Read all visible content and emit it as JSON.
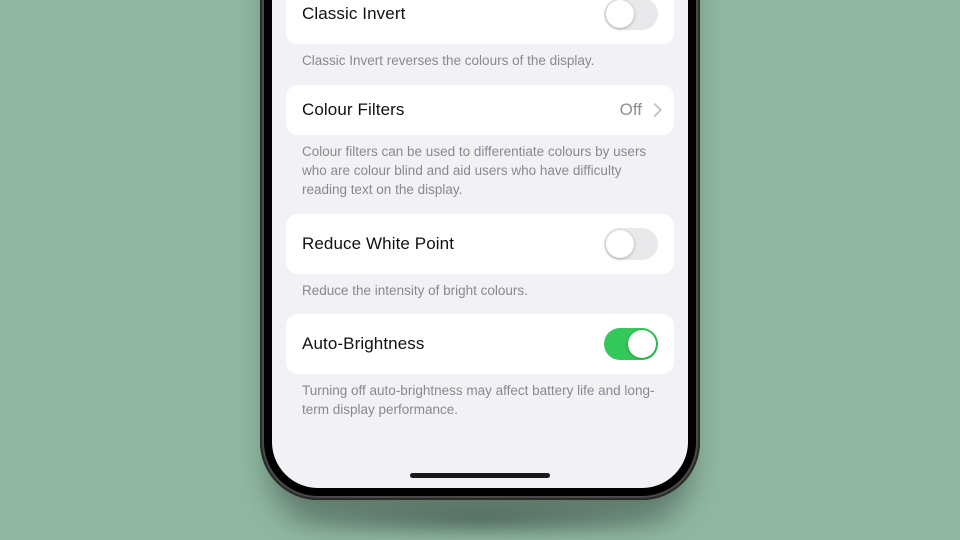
{
  "colors": {
    "background": "#8fb7a2",
    "switch_on": "#34c759",
    "switch_off": "#e9e9eb",
    "row_bg": "#ffffff",
    "screen_bg": "#f2f2f6",
    "footer_text": "#88888e",
    "value_text": "#8e8e93"
  },
  "settings": {
    "classic_invert": {
      "title": "Classic Invert",
      "enabled": false,
      "footer": "Classic Invert reverses the colours of the display."
    },
    "colour_filters": {
      "title": "Colour Filters",
      "value": "Off",
      "footer": "Colour filters can be used to differentiate colours by users who are colour blind and aid users who have difficulty reading text on the display."
    },
    "reduce_white_point": {
      "title": "Reduce White Point",
      "enabled": false,
      "footer": "Reduce the intensity of bright colours."
    },
    "auto_brightness": {
      "title": "Auto-Brightness",
      "enabled": true,
      "footer": "Turning off auto-brightness may affect battery life and long-term display performance."
    }
  }
}
